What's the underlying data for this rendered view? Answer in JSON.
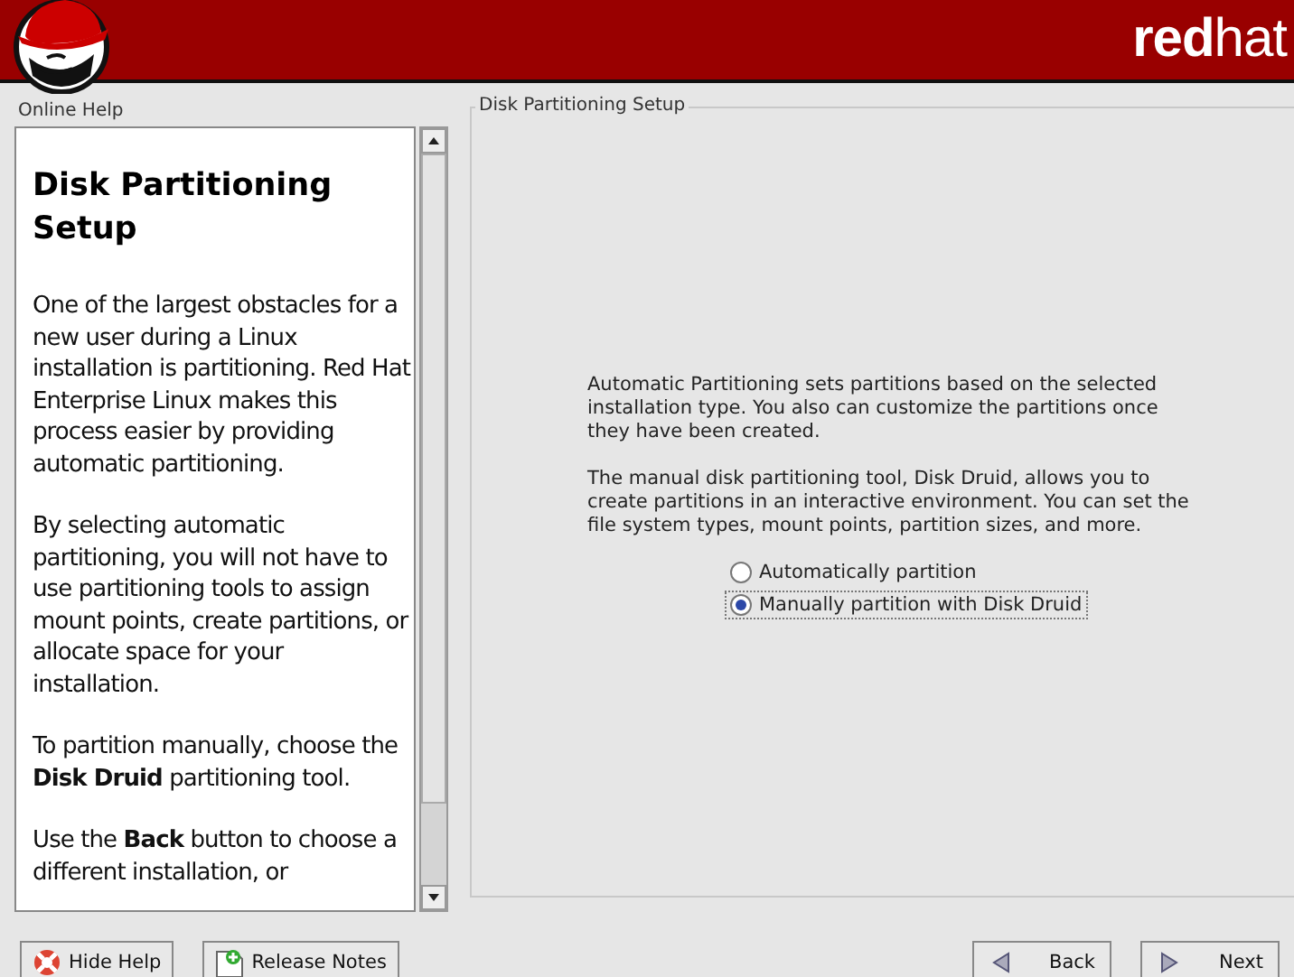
{
  "banner": {
    "wordmark_bold": "red",
    "wordmark_light": "hat"
  },
  "help_pane": {
    "label": "Online Help",
    "title": "Disk Partitioning Setup",
    "paragraphs": [
      "One of the largest obstacles for a new user during a Linux installation is partitioning. Red Hat Enterprise Linux makes this process easier by providing automatic partitioning.",
      "By selecting automatic partitioning, you will not have to use partitioning tools to assign mount points, create partitions, or allocate space for your installation.",
      "To partition manually, choose the **Disk Druid** partitioning tool.",
      "Use the **Back** button to choose a different installation, or"
    ]
  },
  "main_pane": {
    "title": "Disk Partitioning Setup",
    "paragraphs": [
      "Automatic Partitioning sets partitions based on the selected installation type. You also can customize the partitions once they have been created.",
      "The manual disk partitioning tool, Disk Druid, allows you to create partitions in an interactive environment. You can set the file system types, mount points, partition sizes, and more."
    ],
    "options": [
      {
        "label": "Automatically partition",
        "selected": false
      },
      {
        "label": "Manually partition with Disk Druid",
        "selected": true
      }
    ]
  },
  "buttons": [
    {
      "kind": "help",
      "label": "Hide Help"
    },
    {
      "kind": "notes",
      "label": "Release Notes"
    },
    {
      "kind": "back",
      "label": "Back"
    },
    {
      "kind": "next",
      "label": "Next"
    }
  ]
}
